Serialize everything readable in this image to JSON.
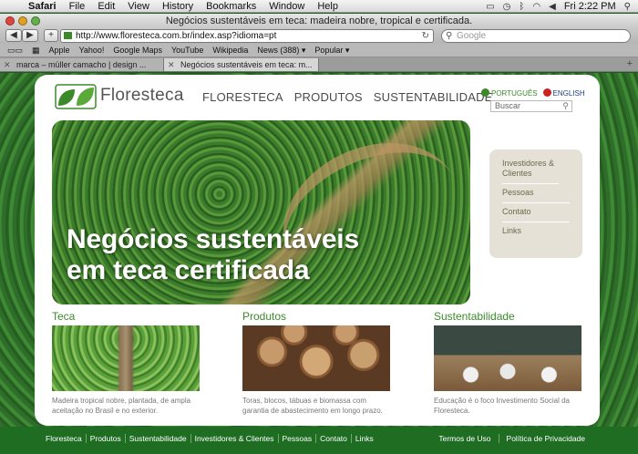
{
  "menubar": {
    "items": [
      "Safari",
      "File",
      "Edit",
      "View",
      "History",
      "Bookmarks",
      "Window",
      "Help"
    ],
    "clock": "Fri 2:22 PM"
  },
  "window": {
    "title": "Negócios sustentáveis em teca: madeira nobre, tropical e certificada."
  },
  "toolbar": {
    "url": "http://www.floresteca.com.br/index.asp?idioma=pt",
    "search_placeholder": "Google"
  },
  "bookmarks": [
    "Apple",
    "Yahoo!",
    "Google Maps",
    "YouTube",
    "Wikipedia",
    "News (388) ▾",
    "Popular ▾"
  ],
  "tabs": [
    {
      "label": "marca – müller camacho | design ..."
    },
    {
      "label": "Negócios sustentáveis em teca: m..."
    }
  ],
  "site": {
    "brand": "Floresteca",
    "nav": [
      "FLORESTECA",
      "PRODUTOS",
      "SUSTENTABILIDADE"
    ],
    "lang_pt": "PORTUGUÊS",
    "lang_en": "ENGLISH",
    "search_placeholder": "Buscar",
    "hero_line1": "Negócios sustentáveis",
    "hero_line2": "em teca certificada",
    "sidebox": [
      {
        "label": "Investidores & Clientes"
      },
      {
        "label": "Pessoas"
      },
      {
        "label": "Contato"
      },
      {
        "label": "Links"
      }
    ],
    "columns": [
      {
        "title": "Teca",
        "text": "Madeira tropical nobre, plantada, de ampla aceitação no Brasil e no exterior."
      },
      {
        "title": "Produtos",
        "text": "Toras, blocos, tábuas e biomassa com garantia de abastecimento em longo prazo."
      },
      {
        "title": "Sustentabilidade",
        "text": "Educação é o foco Investimento Social da Floresteca."
      }
    ],
    "footer_links": [
      "Floresteca",
      "Produtos",
      "Sustentabilidade",
      "Investidores & Clientes",
      "Pessoas",
      "Contato",
      "Links"
    ],
    "footer_legal": [
      "Termos de Uso",
      "Política de Privacidade"
    ]
  },
  "colors": {
    "brand_green": "#3b8a2a",
    "footer_green": "#1e6d23"
  }
}
